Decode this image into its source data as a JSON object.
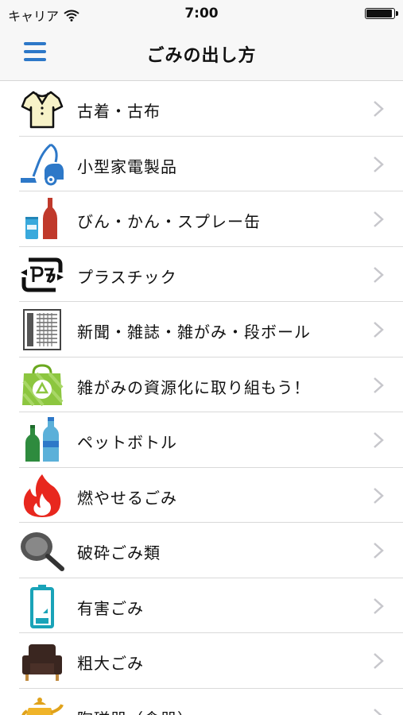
{
  "status_bar": {
    "carrier": "キャリア",
    "time": "7:00",
    "battery_level": 0.95
  },
  "nav": {
    "title": "ごみの出し方",
    "menu_icon": "hamburger-menu-icon",
    "accent_color": "#2d78c8"
  },
  "items": [
    {
      "label": "古着・古布",
      "icon": "shirt-icon"
    },
    {
      "label": "小型家電製品",
      "icon": "vacuum-cleaner-icon"
    },
    {
      "label": "びん・かん・スプレー缶",
      "icon": "bottle-can-icon"
    },
    {
      "label": "プラスチック",
      "icon": "plastic-recycle-icon"
    },
    {
      "label": "新聞・雑誌・雑がみ・段ボール",
      "icon": "newspaper-icon"
    },
    {
      "label": "雑がみの資源化に取り組もう！",
      "icon": "recycle-bag-icon"
    },
    {
      "label": "ペットボトル",
      "icon": "pet-bottle-icon"
    },
    {
      "label": "燃やせるごみ",
      "icon": "fire-icon"
    },
    {
      "label": "破砕ごみ類",
      "icon": "frying-pan-icon"
    },
    {
      "label": "有害ごみ",
      "icon": "battery-icon"
    },
    {
      "label": "粗大ごみ",
      "icon": "sofa-icon"
    },
    {
      "label": "陶磁器（食器）",
      "icon": "teapot-icon"
    }
  ]
}
